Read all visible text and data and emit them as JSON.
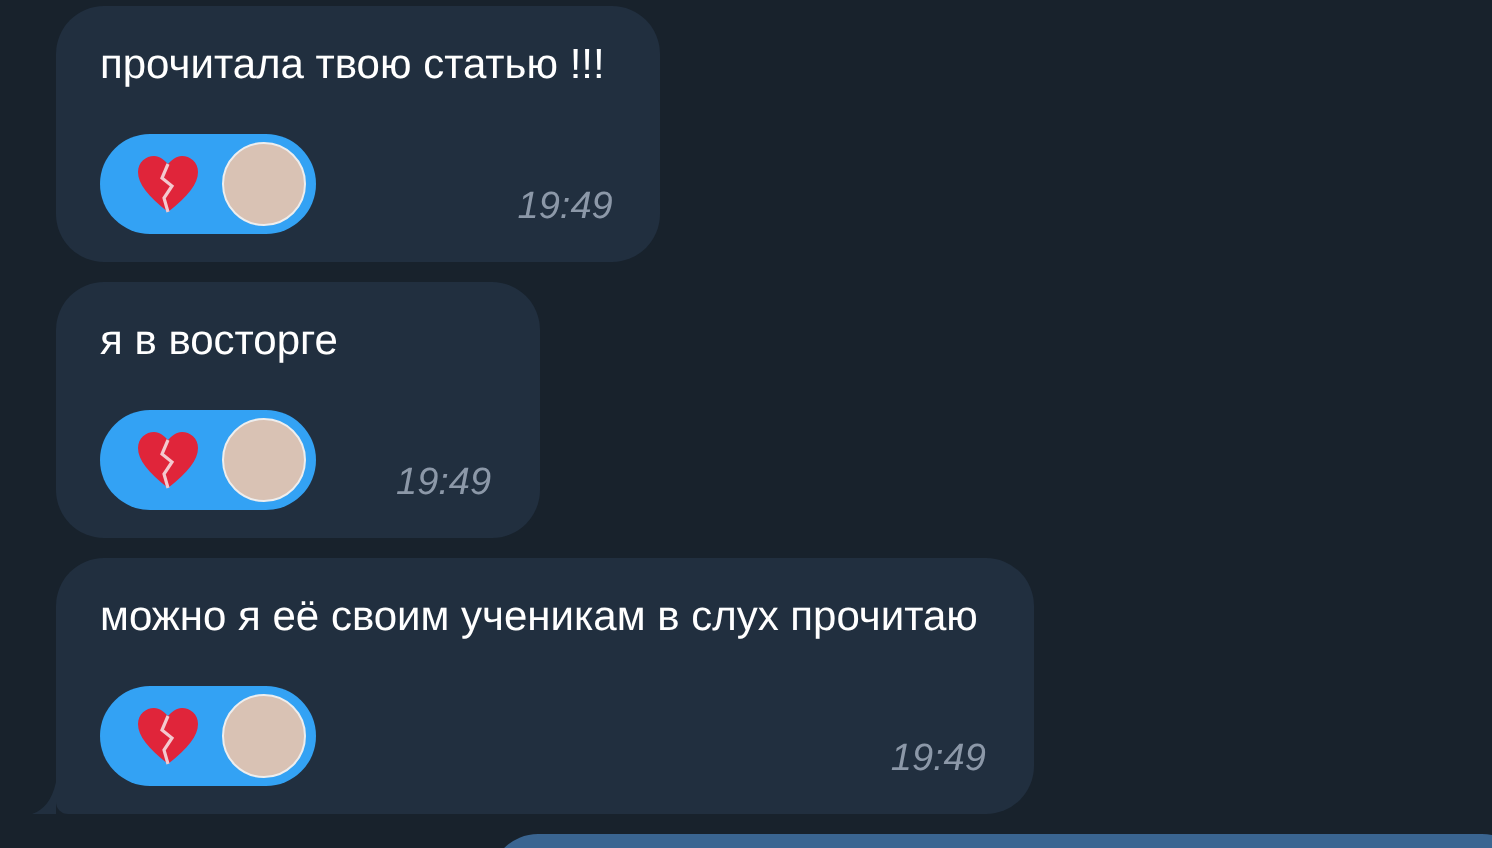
{
  "messages": [
    {
      "text": "прочитала твою статью !!!",
      "time": "19:49",
      "reaction": {
        "selected": true
      },
      "tail": false
    },
    {
      "text": "я в восторге",
      "time": "19:49",
      "reaction": {
        "selected": true
      },
      "tail": false
    },
    {
      "text": "можно я её своим ученикам в слух прочитаю",
      "time": "19:49",
      "reaction": {
        "selected": true
      },
      "tail": true
    }
  ]
}
